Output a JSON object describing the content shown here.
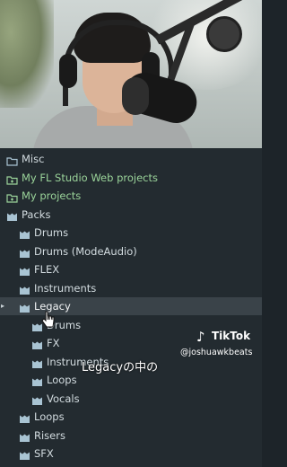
{
  "browser": {
    "items": [
      {
        "label": "Misc",
        "icon": "folder-outline-icon",
        "indent": 0,
        "color": "#d3dce0"
      },
      {
        "label": "My FL Studio Web projects",
        "icon": "cloud-folder-icon",
        "indent": 0,
        "color": "#9bd49a"
      },
      {
        "label": "My projects",
        "icon": "folder-green-icon",
        "indent": 0,
        "color": "#9bd49a"
      },
      {
        "label": "Packs",
        "icon": "pack-folder-icon",
        "indent": 0,
        "color": "#d3dce0"
      },
      {
        "label": "Drums",
        "icon": "pack-folder-icon",
        "indent": 1,
        "color": "#d3dce0"
      },
      {
        "label": "Drums (ModeAudio)",
        "icon": "pack-folder-icon",
        "indent": 1,
        "color": "#d3dce0"
      },
      {
        "label": "FLEX",
        "icon": "pack-folder-icon",
        "indent": 1,
        "color": "#d3dce0"
      },
      {
        "label": "Instruments",
        "icon": "pack-folder-icon",
        "indent": 1,
        "color": "#d3dce0"
      },
      {
        "label": "Legacy",
        "icon": "pack-folder-icon",
        "indent": 1,
        "color": "#f3f5f6",
        "selected": true,
        "expanded": true
      },
      {
        "label": "Drums",
        "icon": "pack-folder-icon",
        "indent": 2,
        "color": "#d3dce0"
      },
      {
        "label": "FX",
        "icon": "pack-folder-icon",
        "indent": 2,
        "color": "#d3dce0"
      },
      {
        "label": "Instruments",
        "icon": "pack-folder-icon",
        "indent": 2,
        "color": "#d3dce0"
      },
      {
        "label": "Loops",
        "icon": "pack-folder-icon",
        "indent": 2,
        "color": "#d3dce0"
      },
      {
        "label": "Vocals",
        "icon": "pack-folder-icon",
        "indent": 2,
        "color": "#d3dce0"
      },
      {
        "label": "Loops",
        "icon": "pack-folder-icon",
        "indent": 1,
        "color": "#d3dce0"
      },
      {
        "label": "Risers",
        "icon": "pack-folder-icon",
        "indent": 1,
        "color": "#d3dce0"
      },
      {
        "label": "SFX",
        "icon": "pack-folder-icon",
        "indent": 1,
        "color": "#d3dce0"
      }
    ],
    "expand_arrow": "▸"
  },
  "overlay": {
    "tiktok_logo": "♪",
    "tiktok_name": "TikTok",
    "tiktok_handle": "@joshuawkbeats",
    "caption": "Legacyの中の"
  },
  "colors": {
    "panel_bg": "#232b30",
    "selected_bg": "#3a4349",
    "folder_icon": "#a9c4d3",
    "green_text": "#9bd49a"
  }
}
